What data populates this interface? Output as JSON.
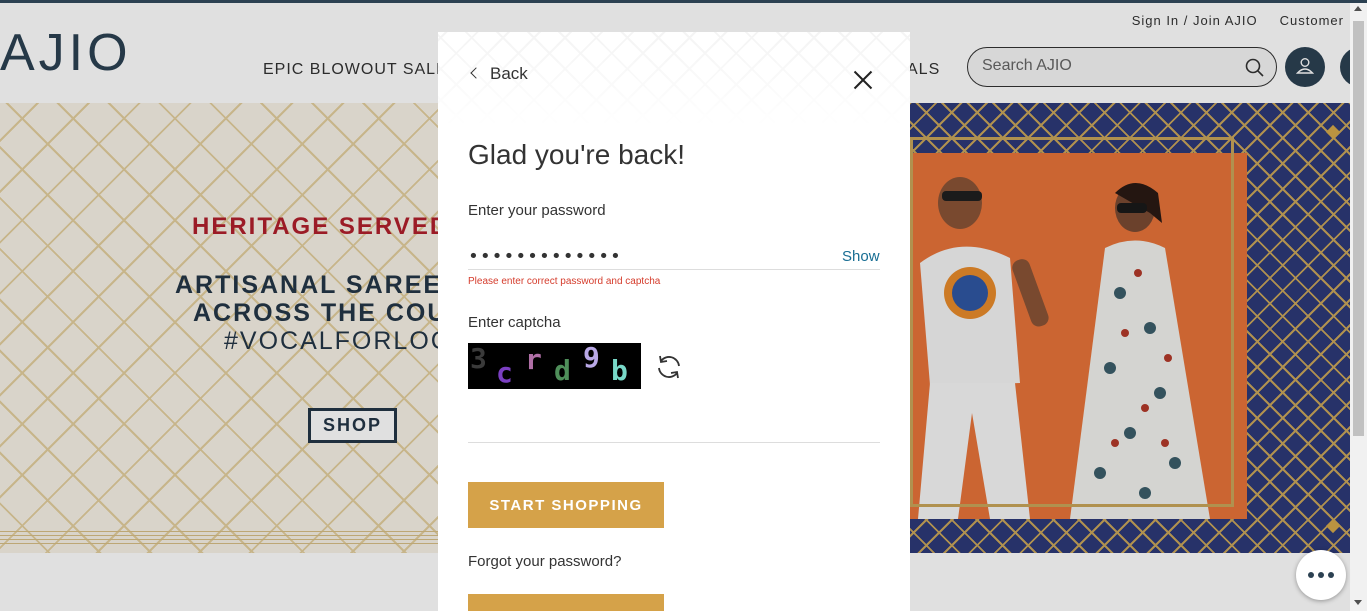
{
  "header": {
    "logo": "AJIO",
    "top_links": {
      "sign_in": "Sign In / Join AJIO",
      "customer": "Customer"
    },
    "nav": {
      "left": "EPIC BLOWOUT SALE",
      "right": "ALS"
    },
    "search": {
      "placeholder": "Search AJIO"
    }
  },
  "banner": {
    "line1": "HERITAGE SERVED",
    "line2": "ARTISANAL SAREES",
    "line3": "ACROSS THE COUN",
    "line4": "#VOCALFORLOC",
    "shop_label": "SHOP"
  },
  "modal": {
    "back_label": "Back",
    "title": "Glad you're back!",
    "password_label": "Enter your password",
    "password_value": "•••••••••••••",
    "show_label": "Show",
    "error_text": "Please enter correct password and captcha",
    "captcha_label": "Enter captcha",
    "captcha_chars": [
      {
        "char": "3",
        "color": "#3a3a3a"
      },
      {
        "char": "c",
        "color": "#7b3fc2"
      },
      {
        "char": "r",
        "color": "#b06fa6"
      },
      {
        "char": "d",
        "color": "#4f8f5a"
      },
      {
        "char": "9",
        "color": "#b9a8e6"
      },
      {
        "char": "b",
        "color": "#78d8c8"
      }
    ],
    "start_label": "START SHOPPING",
    "forgot_label": "Forgot your password?"
  },
  "colors": {
    "brand_navy": "#2c4152",
    "button_gold": "#d5a249",
    "error_red": "#d53c2c",
    "link_blue": "#176d93"
  },
  "icons": [
    "search-icon",
    "user-icon",
    "chevron-left-icon",
    "close-icon",
    "refresh-icon",
    "more-dots-icon"
  ]
}
